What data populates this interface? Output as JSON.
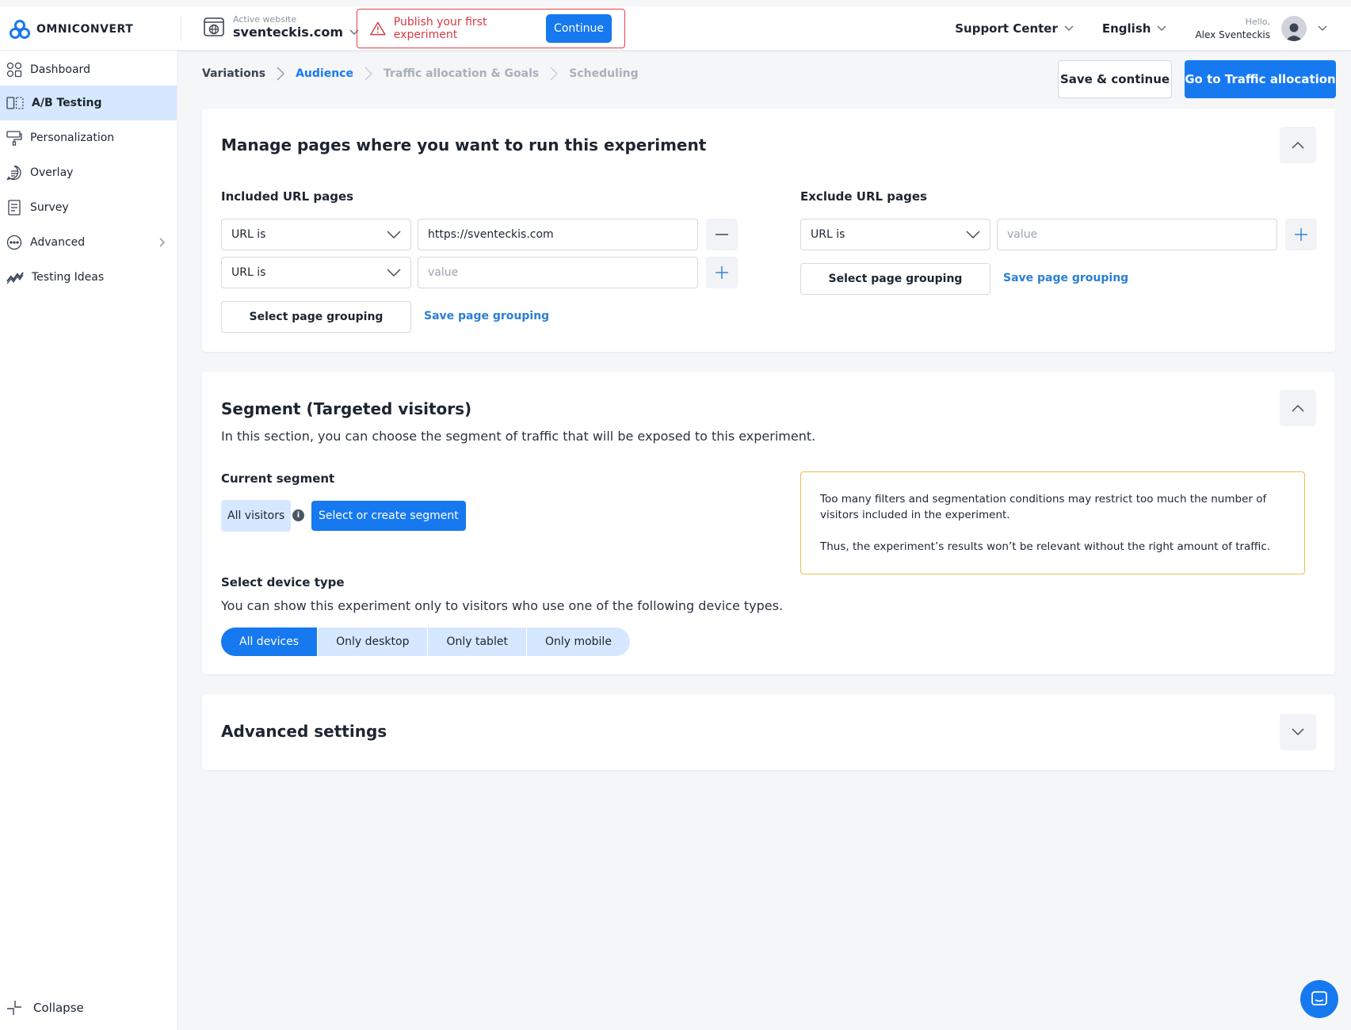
{
  "brand": {
    "name": "OMNICONVERT",
    "accent": "#1779ef"
  },
  "site": {
    "label": "Active website",
    "name": "sventeckis.com"
  },
  "banner": {
    "text": "Publish your first experiment",
    "button": "Continue"
  },
  "header": {
    "support": "Support Center",
    "language": "English",
    "hello": "Hello,",
    "user": "Alex Sventeckis"
  },
  "sidebar": {
    "items": [
      {
        "label": "Dashboard",
        "icon": "dashboard-icon"
      },
      {
        "label": "A/B Testing",
        "icon": "ab-testing-icon",
        "active": true
      },
      {
        "label": "Personalization",
        "icon": "personalization-icon"
      },
      {
        "label": "Overlay",
        "icon": "overlay-icon"
      },
      {
        "label": "Survey",
        "icon": "survey-icon"
      },
      {
        "label": "Advanced",
        "icon": "advanced-icon"
      },
      {
        "label": "Testing Ideas",
        "icon": "testing-ideas-icon"
      }
    ],
    "collapse": "Collapse"
  },
  "breadcrumb": [
    "Variations",
    "Audience",
    "Traffic allocation & Goals",
    "Scheduling"
  ],
  "actions": {
    "save": "Save & continue",
    "next": "Go to Traffic allocation"
  },
  "pages": {
    "title": "Manage pages where you want to run this experiment",
    "included_label": "Included URL pages",
    "excluded_label": "Exclude URL pages",
    "included_rows": [
      {
        "condition": "URL is",
        "value": "https://sventeckis.com",
        "placeholder": "value"
      },
      {
        "condition": "URL is",
        "value": "",
        "placeholder": "value"
      }
    ],
    "excluded_rows": [
      {
        "condition": "URL is",
        "value": "",
        "placeholder": "value"
      }
    ],
    "select_grouping": "Select page grouping",
    "save_grouping": "Save page grouping"
  },
  "segment": {
    "title": "Segment (Targeted visitors)",
    "description": "In this section, you can choose the segment of traffic that will be exposed to this experiment.",
    "current_label": "Current segment",
    "current_value": "All visitors",
    "select_button": "Select or create segment",
    "warning_line1": "Too many filters and segmentation conditions may restrict too much the number of visitors included in the experiment.",
    "warning_line2": "Thus, the experiment’s results won’t be relevant without the right amount of traffic.",
    "device_label": "Select device type",
    "device_desc": "You can show this experiment only to visitors who use one of the following device types.",
    "devices": [
      "All devices",
      "Only desktop",
      "Only tablet",
      "Only mobile"
    ],
    "selected_device": "All devices"
  },
  "advanced": {
    "title": "Advanced settings"
  }
}
